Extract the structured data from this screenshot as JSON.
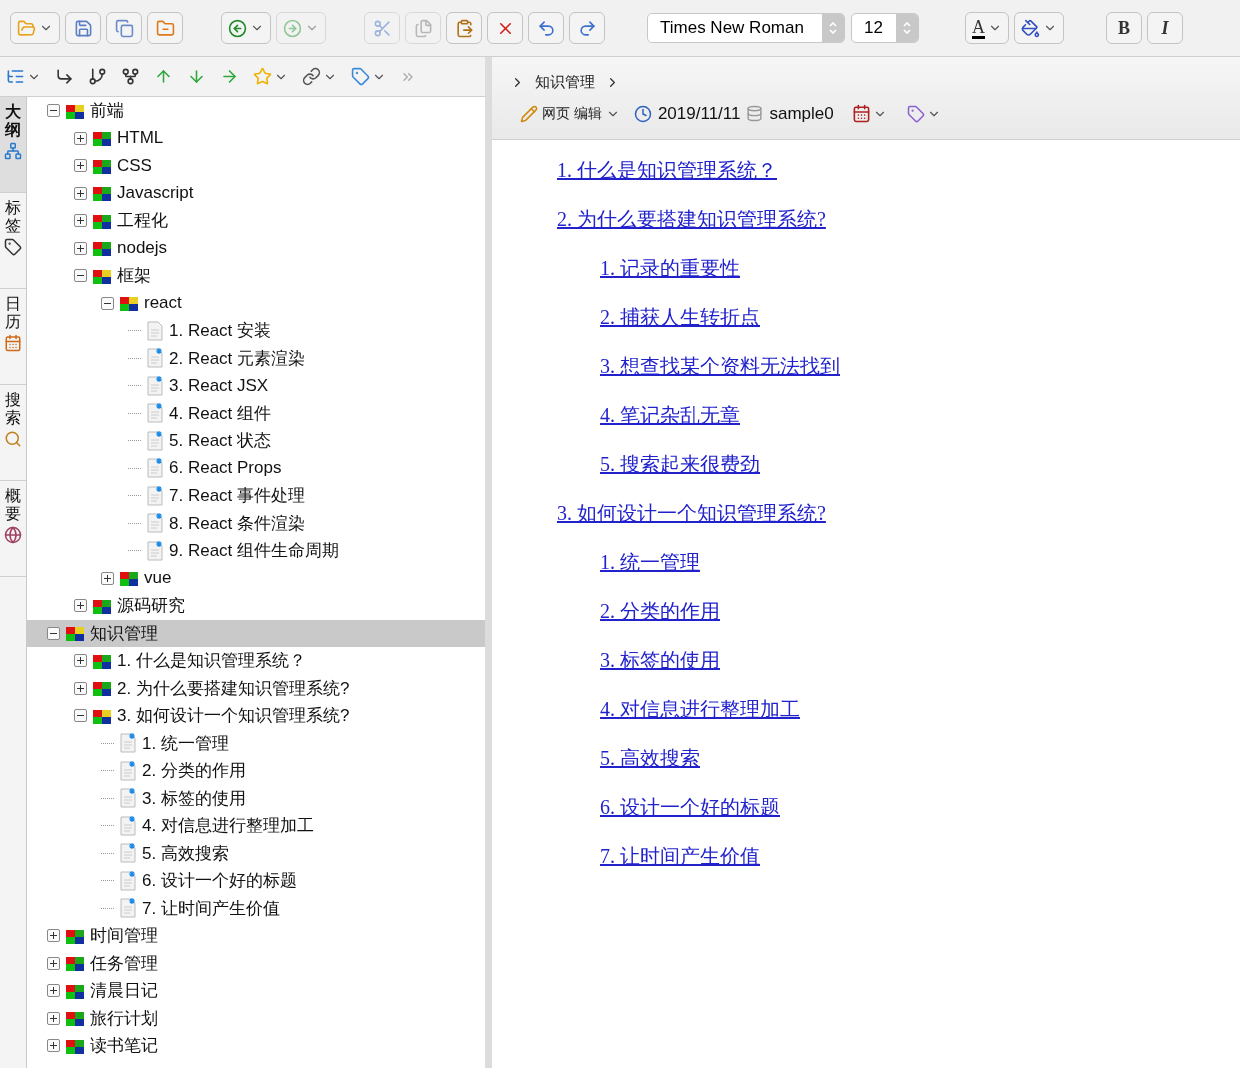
{
  "toolbar": {
    "groups": [
      {
        "buttons": [
          {
            "dropdown": true
          },
          {
            "dropdown": false
          },
          {
            "dropdown": false
          },
          {
            "dropdown": false
          }
        ]
      },
      {
        "buttons": [
          {
            "dropdown": true,
            "disabled": false
          },
          {
            "dropdown": true,
            "disabled": true
          }
        ]
      },
      {
        "buttons": [
          {
            "disabled": true
          },
          {
            "disabled": true
          },
          {
            "disabled": false
          },
          {
            "disabled": false
          },
          {
            "disabled": false
          },
          {
            "disabled": false
          }
        ]
      }
    ],
    "font_name": "Times New Roman",
    "font_size": "12",
    "format_buttons": [
      {
        "label": "A",
        "dropdown": true
      },
      {
        "dropdown": true
      }
    ],
    "style_buttons": [
      {
        "label": "B"
      },
      {
        "label": "I"
      }
    ]
  },
  "tree_toolbar": {
    "buttons": [
      {
        "dropdown": true
      },
      {
        "dropdown": false
      },
      {
        "dropdown": false
      },
      {
        "dropdown": false
      },
      {
        "dropdown": false
      },
      {
        "dropdown": false
      },
      {
        "dropdown": false
      },
      {
        "dropdown": true
      },
      {
        "dropdown": true
      },
      {
        "dropdown": true
      }
    ]
  },
  "side_tabs": [
    {
      "label": "大纲",
      "selected": true
    },
    {
      "label": "标签",
      "selected": false
    },
    {
      "label": "日历",
      "selected": false
    },
    {
      "label": "搜索",
      "selected": false
    },
    {
      "label": "概要",
      "selected": false
    }
  ],
  "tree": [
    {
      "label": "前端",
      "kind": "folder",
      "expanded": true,
      "selected": false,
      "children": [
        {
          "label": "HTML",
          "kind": "folder",
          "expanded": false,
          "selected": false
        },
        {
          "label": "CSS",
          "kind": "folder",
          "expanded": false,
          "selected": false
        },
        {
          "label": "Javascript",
          "kind": "folder",
          "expanded": false,
          "selected": false
        },
        {
          "label": "工程化",
          "kind": "folder",
          "expanded": false,
          "selected": false
        },
        {
          "label": "nodejs",
          "kind": "folder",
          "expanded": false,
          "selected": false
        },
        {
          "label": "框架",
          "kind": "folder",
          "expanded": true,
          "selected": false,
          "children": [
            {
              "label": "react",
              "kind": "folder",
              "expanded": true,
              "selected": false,
              "children": [
                {
                  "label": "1.  React 安装",
                  "kind": "page",
                  "selected": false
                },
                {
                  "label": "2.  React 元素渲染",
                  "kind": "note",
                  "selected": false
                },
                {
                  "label": "3.  React JSX",
                  "kind": "note",
                  "selected": false
                },
                {
                  "label": "4.  React 组件",
                  "kind": "note",
                  "selected": false
                },
                {
                  "label": "5.  React 状态",
                  "kind": "note",
                  "selected": false
                },
                {
                  "label": "6.  React Props",
                  "kind": "note",
                  "selected": false
                },
                {
                  "label": "7.  React 事件处理",
                  "kind": "note",
                  "selected": false
                },
                {
                  "label": "8.  React 条件渲染",
                  "kind": "note",
                  "selected": false
                },
                {
                  "label": "9.  React 组件生命周期",
                  "kind": "note",
                  "selected": false
                }
              ]
            },
            {
              "label": "vue",
              "kind": "folder",
              "expanded": false,
              "selected": false
            }
          ]
        },
        {
          "label": "源码研究",
          "kind": "folder",
          "expanded": false,
          "selected": false
        }
      ]
    },
    {
      "label": "知识管理",
      "kind": "folder",
      "expanded": true,
      "selected": true,
      "children": [
        {
          "label": "1. 什么是知识管理系统？",
          "kind": "folder",
          "expanded": false,
          "selected": false
        },
        {
          "label": "2. 为什么要搭建知识管理系统?",
          "kind": "folder",
          "expanded": false,
          "selected": false
        },
        {
          "label": "3. 如何设计一个知识管理系统?",
          "kind": "folder",
          "expanded": true,
          "selected": false,
          "children": [
            {
              "label": "1.  统一管理",
              "kind": "note",
              "selected": false
            },
            {
              "label": "2.  分类的作用",
              "kind": "note",
              "selected": false
            },
            {
              "label": "3.  标签的使用",
              "kind": "note",
              "selected": false
            },
            {
              "label": "4.  对信息进行整理加工",
              "kind": "note",
              "selected": false
            },
            {
              "label": "5.  高效搜索",
              "kind": "note",
              "selected": false
            },
            {
              "label": "6.  设计一个好的标题",
              "kind": "note",
              "selected": false
            },
            {
              "label": "7.  让时间产生价值",
              "kind": "note",
              "selected": false
            }
          ]
        }
      ]
    },
    {
      "label": "时间管理",
      "kind": "folder",
      "expanded": false,
      "selected": false
    },
    {
      "label": "任务管理",
      "kind": "folder",
      "expanded": false,
      "selected": false
    },
    {
      "label": "清晨日记",
      "kind": "folder",
      "expanded": false,
      "selected": false
    },
    {
      "label": "旅行计划",
      "kind": "folder",
      "expanded": false,
      "selected": false
    },
    {
      "label": "读书笔记",
      "kind": "folder",
      "expanded": false,
      "selected": false
    }
  ],
  "breadcrumb": [
    "知识管理"
  ],
  "doc_bar": {
    "editor_mode": "网页 编辑",
    "date": "2019/11/11",
    "database": "sample0"
  },
  "content": {
    "links": [
      {
        "label": "1. 什么是知识管理系统？"
      },
      {
        "label": "2. 为什么要搭建知识管理系统?",
        "children": [
          {
            "label": "1. 记录的重要性"
          },
          {
            "label": "2. 捕获人生转折点"
          },
          {
            "label": "3. 想查找某个资料无法找到"
          },
          {
            "label": "4. 笔记杂乱无章"
          },
          {
            "label": "5. 搜索起来很费劲"
          }
        ]
      },
      {
        "label": "3. 如何设计一个知识管理系统?",
        "children": [
          {
            "label": "1. 统一管理"
          },
          {
            "label": "2. 分类的作用"
          },
          {
            "label": "3. 标签的使用"
          },
          {
            "label": "4. 对信息进行整理加工"
          },
          {
            "label": "5. 高效搜索"
          },
          {
            "label": "6. 设计一个好的标题"
          },
          {
            "label": "7. 让时间产生价值"
          }
        ]
      }
    ]
  }
}
